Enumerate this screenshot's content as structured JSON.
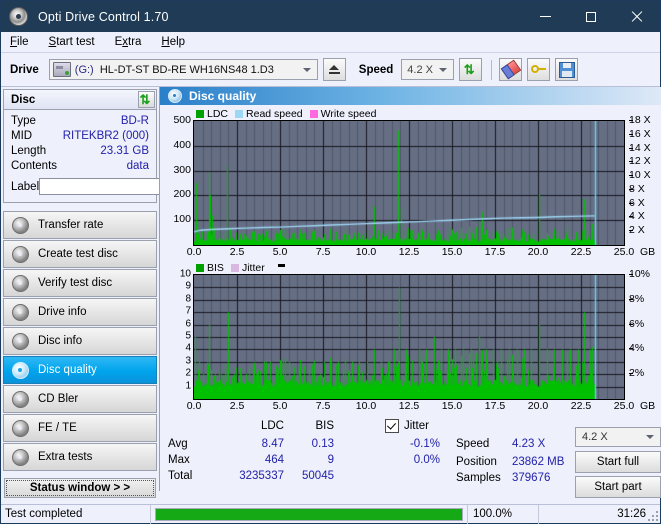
{
  "window": {
    "title": "Opti Drive Control 1.70",
    "icon": "disc-icon",
    "minimize": "–",
    "maximize": "□",
    "close": "✕"
  },
  "menu": [
    {
      "label": "File",
      "mnemonic": "F"
    },
    {
      "label": "Start test",
      "mnemonic": "S"
    },
    {
      "label": "Extra",
      "mnemonic": "x"
    },
    {
      "label": "Help",
      "mnemonic": "H"
    }
  ],
  "toolbar": {
    "drive_label": "Drive",
    "drive_letter": "(G:)",
    "drive_name": "HL-DT-ST BD-RE  WH16NS48 1.D3",
    "eject_icon": "eject-icon",
    "speed_label": "Speed",
    "speed_value": "4.2 X",
    "refresh_icon": "refresh-icon",
    "erase_icon": "eraser-icon",
    "key_icon": "key-icon",
    "save_icon": "save-icon"
  },
  "disc_panel": {
    "title": "Disc",
    "refresh_icon": "refresh-icon",
    "rows": [
      {
        "key": "Type",
        "value": "BD-R"
      },
      {
        "key": "MID",
        "value": "RITEKBR2 (000)"
      },
      {
        "key": "Length",
        "value": "23.31 GB"
      },
      {
        "key": "Contents",
        "value": "data"
      }
    ],
    "label_key": "Label",
    "label_value": "",
    "label_button_icon": "disc-icon"
  },
  "nav": {
    "items": [
      {
        "label": "Transfer rate",
        "active": false
      },
      {
        "label": "Create test disc",
        "active": false
      },
      {
        "label": "Verify test disc",
        "active": false
      },
      {
        "label": "Drive info",
        "active": false
      },
      {
        "label": "Disc info",
        "active": false
      },
      {
        "label": "Disc quality",
        "active": true
      },
      {
        "label": "CD Bler",
        "active": false
      },
      {
        "label": "FE / TE",
        "active": false
      },
      {
        "label": "Extra tests",
        "active": false
      }
    ],
    "status_window": "Status window > >"
  },
  "panel": {
    "title": "Disc quality",
    "icon": "disc-icon"
  },
  "chart_data": [
    {
      "type": "line",
      "id": "ldc-chart",
      "title": "",
      "legend": [
        {
          "label": "LDC",
          "color": "#00a000"
        },
        {
          "label": "Read speed",
          "color": "#9bd8f5"
        },
        {
          "label": "Write speed",
          "color": "#ff6ae0"
        }
      ],
      "legend_position": "top-left",
      "xlabel": "GB",
      "x_unit": "GB",
      "xlim": [
        0,
        25.0
      ],
      "xticks": [
        0.0,
        2.5,
        5.0,
        7.5,
        10.0,
        12.5,
        15.0,
        17.5,
        20.0,
        22.5,
        25.0
      ],
      "ylabel": "",
      "ylim": [
        0,
        500
      ],
      "yticks": [
        100,
        200,
        300,
        400,
        500
      ],
      "y2label": "X",
      "y2lim": [
        0,
        18
      ],
      "y2ticks": [
        2,
        4,
        6,
        8,
        10,
        12,
        14,
        16,
        18
      ],
      "grid": true,
      "data_end_x": 23.31,
      "series": [
        {
          "name": "LDC",
          "color": "#00c000",
          "kind": "impulse",
          "baseline": 14,
          "noise": 12,
          "spikes": [
            [
              0.1,
              250
            ],
            [
              0.18,
              95
            ],
            [
              0.3,
              60
            ],
            [
              0.45,
              55
            ],
            [
              0.62,
              48
            ],
            [
              0.86,
              293
            ],
            [
              0.92,
              200
            ],
            [
              1.05,
              120
            ],
            [
              1.18,
              70
            ],
            [
              1.45,
              58
            ],
            [
              1.9,
              322
            ],
            [
              2.1,
              65
            ],
            [
              2.45,
              50
            ],
            [
              2.9,
              45
            ],
            [
              3.4,
              52
            ],
            [
              3.95,
              48
            ],
            [
              4.25,
              62
            ],
            [
              4.7,
              45
            ],
            [
              5.2,
              50
            ],
            [
              5.7,
              46
            ],
            [
              6.3,
              44
            ],
            [
              6.9,
              48
            ],
            [
              7.55,
              45
            ],
            [
              8.1,
              52
            ],
            [
              8.7,
              44
            ],
            [
              9.3,
              48
            ],
            [
              9.95,
              50
            ],
            [
              10.45,
              155
            ],
            [
              10.7,
              60
            ],
            [
              11.1,
              58
            ],
            [
              11.55,
              52
            ],
            [
              11.85,
              462
            ],
            [
              12.05,
              152
            ],
            [
              12.55,
              58
            ],
            [
              13.0,
              50
            ],
            [
              13.6,
              48
            ],
            [
              14.2,
              55
            ],
            [
              14.8,
              46
            ],
            [
              15.4,
              52
            ],
            [
              16.0,
              48
            ],
            [
              16.55,
              95
            ],
            [
              16.75,
              132
            ],
            [
              16.95,
              60
            ],
            [
              17.4,
              55
            ],
            [
              17.95,
              48
            ],
            [
              18.55,
              52
            ],
            [
              19.15,
              46
            ],
            [
              19.7,
              50
            ],
            [
              20.05,
              205
            ],
            [
              20.55,
              48
            ],
            [
              21.1,
              55
            ],
            [
              21.65,
              46
            ],
            [
              22.2,
              52
            ],
            [
              22.7,
              185
            ],
            [
              22.85,
              60
            ],
            [
              23.1,
              50
            ]
          ]
        },
        {
          "name": "Read speed",
          "color": "#9fd9f7",
          "kind": "line",
          "points": [
            [
              0.0,
              1.9
            ],
            [
              0.4,
              2.15
            ],
            [
              1.0,
              2.25
            ],
            [
              2.0,
              2.35
            ],
            [
              3.0,
              2.45
            ],
            [
              4.0,
              2.55
            ],
            [
              5.0,
              2.6
            ],
            [
              6.0,
              2.7
            ],
            [
              7.0,
              2.8
            ],
            [
              8.0,
              2.9
            ],
            [
              9.0,
              3.0
            ],
            [
              10.0,
              3.1
            ],
            [
              11.0,
              3.2
            ],
            [
              12.0,
              3.3
            ],
            [
              13.0,
              3.4
            ],
            [
              14.0,
              3.5
            ],
            [
              15.0,
              3.6
            ],
            [
              16.0,
              3.7
            ],
            [
              17.0,
              3.8
            ],
            [
              18.0,
              3.9
            ],
            [
              19.0,
              3.95
            ],
            [
              20.0,
              4.0
            ],
            [
              21.0,
              4.1
            ],
            [
              22.0,
              4.15
            ],
            [
              23.3,
              4.23
            ]
          ]
        },
        {
          "name": "End marker",
          "color": "#66d9f2",
          "kind": "vline",
          "x": 23.31
        }
      ]
    },
    {
      "type": "line",
      "id": "bis-chart",
      "title": "",
      "legend": [
        {
          "label": "BIS",
          "color": "#00a000"
        },
        {
          "label": "Jitter",
          "color": "#d9b8e0"
        }
      ],
      "legend_position": "top-left",
      "xlabel": "GB",
      "x_unit": "GB",
      "xlim": [
        0,
        25.0
      ],
      "xticks": [
        0.0,
        2.5,
        5.0,
        7.5,
        10.0,
        12.5,
        15.0,
        17.5,
        20.0,
        22.5,
        25.0
      ],
      "ylabel": "",
      "ylim": [
        0,
        10
      ],
      "yticks": [
        1,
        2,
        3,
        4,
        5,
        6,
        7,
        8,
        9,
        10
      ],
      "y2label": "%",
      "y2lim": [
        0,
        10
      ],
      "y2ticks": [
        2,
        4,
        6,
        8,
        10
      ],
      "grid": true,
      "data_end_x": 23.31,
      "series": [
        {
          "name": "BIS",
          "color": "#00c000",
          "kind": "impulse",
          "baseline": 1.0,
          "noise": 0.55,
          "spikes": [
            [
              0.08,
              5.0
            ],
            [
              0.3,
              3.0
            ],
            [
              0.55,
              2.0
            ],
            [
              0.88,
              6.0
            ],
            [
              1.2,
              2.0
            ],
            [
              1.55,
              2.0
            ],
            [
              1.95,
              7.0
            ],
            [
              2.35,
              2.0
            ],
            [
              2.75,
              2.0
            ],
            [
              3.2,
              2.0
            ],
            [
              3.6,
              2.0
            ],
            [
              4.05,
              3.0
            ],
            [
              4.4,
              3.0
            ],
            [
              4.8,
              2.0
            ],
            [
              5.2,
              3.0
            ],
            [
              5.55,
              3.0
            ],
            [
              6.0,
              2.0
            ],
            [
              6.4,
              2.0
            ],
            [
              6.85,
              2.0
            ],
            [
              7.3,
              2.0
            ],
            [
              7.55,
              3.0
            ],
            [
              7.95,
              3.0
            ],
            [
              8.35,
              3.0
            ],
            [
              8.8,
              3.0
            ],
            [
              9.2,
              3.0
            ],
            [
              9.6,
              3.0
            ],
            [
              10.05,
              3.0
            ],
            [
              10.45,
              4.0
            ],
            [
              10.85,
              3.0
            ],
            [
              11.25,
              3.0
            ],
            [
              11.6,
              4.0
            ],
            [
              11.9,
              9.0
            ],
            [
              12.3,
              4.0
            ],
            [
              12.7,
              3.0
            ],
            [
              13.1,
              4.0
            ],
            [
              13.5,
              4.0
            ],
            [
              13.95,
              5.0
            ],
            [
              14.35,
              4.0
            ],
            [
              14.75,
              4.0
            ],
            [
              15.2,
              4.0
            ],
            [
              15.65,
              4.0
            ],
            [
              16.1,
              4.0
            ],
            [
              16.55,
              5.0
            ],
            [
              16.95,
              4.0
            ],
            [
              17.4,
              4.0
            ],
            [
              17.85,
              4.0
            ],
            [
              18.3,
              4.0
            ],
            [
              18.75,
              4.0
            ],
            [
              19.2,
              4.0
            ],
            [
              19.6,
              4.0
            ],
            [
              20.05,
              6.0
            ],
            [
              20.5,
              4.0
            ],
            [
              20.95,
              4.0
            ],
            [
              21.4,
              4.0
            ],
            [
              21.85,
              4.0
            ],
            [
              22.3,
              4.0
            ],
            [
              22.7,
              7.0
            ],
            [
              23.0,
              4.0
            ]
          ]
        },
        {
          "name": "End marker",
          "color": "#66d9f2",
          "kind": "vline",
          "x": 23.31
        }
      ]
    }
  ],
  "stats": {
    "col_headers": [
      "LDC",
      "BIS"
    ],
    "rows": [
      {
        "label": "Avg",
        "ldc": "8.47",
        "bis": "0.13"
      },
      {
        "label": "Max",
        "ldc": "464",
        "bis": "9"
      },
      {
        "label": "Total",
        "ldc": "3235337",
        "bis": "50045"
      }
    ],
    "jitter": {
      "checked": true,
      "label": "Jitter",
      "avg": "-0.1%",
      "max": "0.0%"
    },
    "speed_label": "Speed",
    "speed_value": "4.23 X",
    "position_label": "Position",
    "position_value": "23862 MB",
    "samples_label": "Samples",
    "samples_value": "379676",
    "speed_select": "4.2 X",
    "start_full": "Start full",
    "start_part": "Start part"
  },
  "statusbar": {
    "message": "Test completed",
    "progress_percent": 100.0,
    "progress_text": "100.0%",
    "elapsed": "31:26"
  },
  "colors": {
    "accent": "#00a4ec",
    "titlebar": "#1f3b55",
    "plot_bg": "#666e84",
    "ldc_green": "#00c000",
    "read_speed": "#9fd9f7",
    "value_blue": "#2222aa",
    "progress_green": "#16a916"
  }
}
